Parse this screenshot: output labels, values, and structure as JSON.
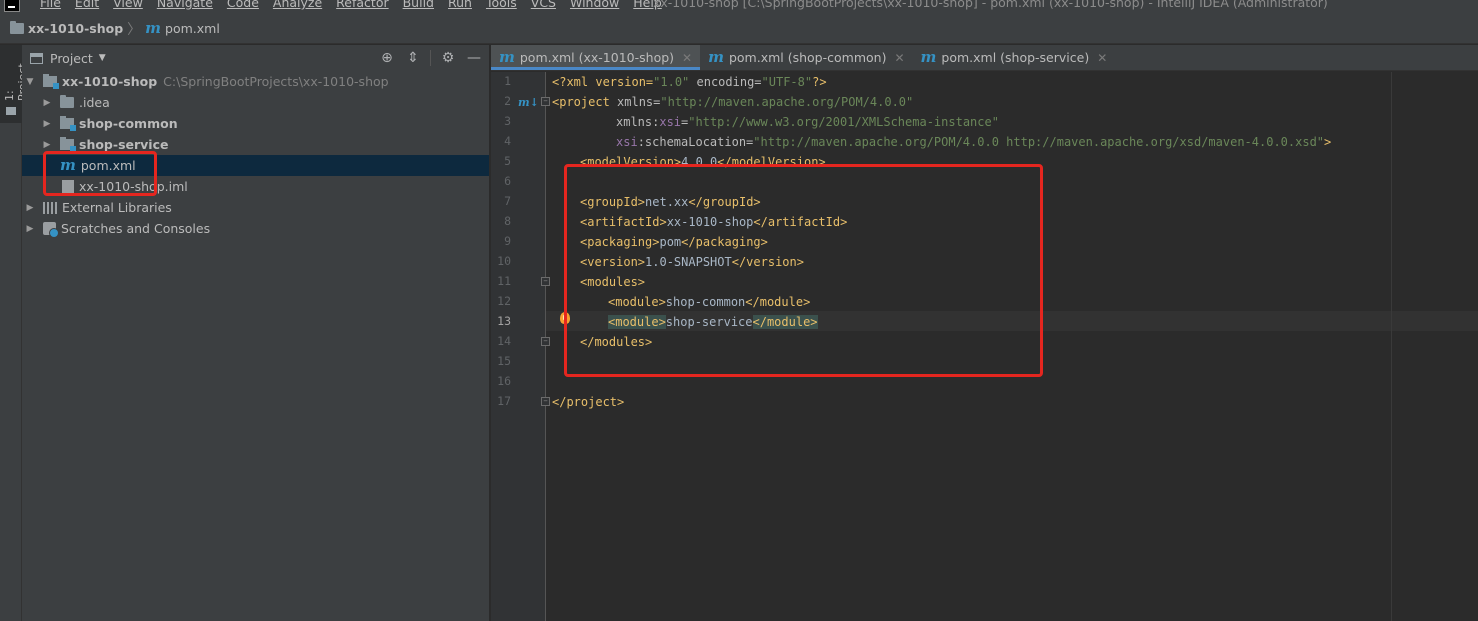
{
  "window": {
    "title": "xx-1010-shop [C:\\SpringBootProjects\\xx-1010-shop] - pom.xml (xx-1010-shop) - IntelliJ IDEA (Administrator)"
  },
  "menu": [
    "File",
    "Edit",
    "View",
    "Navigate",
    "Code",
    "Analyze",
    "Refactor",
    "Build",
    "Run",
    "Tools",
    "VCS",
    "Window",
    "Help"
  ],
  "breadcrumb": {
    "project": "xx-1010-shop",
    "file": "pom.xml"
  },
  "toolstrip": {
    "project_tab": "1: Project"
  },
  "project_panel": {
    "title": "Project",
    "tree": [
      {
        "label": "xx-1010-shop",
        "path": "C:\\SpringBootProjects\\xx-1010-shop"
      },
      {
        "label": ".idea"
      },
      {
        "label": "shop-common"
      },
      {
        "label": "shop-service"
      },
      {
        "label": "pom.xml"
      },
      {
        "label": "xx-1010-shop.iml"
      },
      {
        "label": "External Libraries"
      },
      {
        "label": "Scratches and Consoles"
      }
    ]
  },
  "editor": {
    "tabs": [
      {
        "label": "pom.xml (xx-1010-shop)",
        "active": true
      },
      {
        "label": "pom.xml (shop-common)",
        "active": false
      },
      {
        "label": "pom.xml (shop-service)",
        "active": false
      }
    ],
    "current_line": 13,
    "line_numbers": [
      "1",
      "2",
      "3",
      "4",
      "5",
      "6",
      "7",
      "8",
      "9",
      "10",
      "11",
      "12",
      "13",
      "14",
      "15",
      "16",
      "17"
    ],
    "code": {
      "l1_open": "<?xml version=",
      "l1_v": "\"1.0\"",
      "l1_mid": " encoding=",
      "l1_e": "\"UTF-8\"",
      "l1_close": "?>",
      "l2_tag": "<project ",
      "l2_attr": "xmlns=",
      "l2_val": "\"http://maven.apache.org/POM/4.0.0\"",
      "l3_attr": "xmlns:",
      "l3_ns": "xsi",
      "l3_eq": "=",
      "l3_val": "\"http://www.w3.org/2001/XMLSchema-instance\"",
      "l4_ns": "xsi",
      "l4_attr": ":schemaLocation=",
      "l4_val": "\"http://maven.apache.org/POM/4.0.0 http://maven.apache.org/xsd/maven-4.0.0.xsd\"",
      "l4_close": ">",
      "l5_open": "<modelVersion>",
      "l5_text": "4.0.0",
      "l5_close": "</modelVersion>",
      "l7_open": "<groupId>",
      "l7_text": "net.xx",
      "l7_close": "</groupId>",
      "l8_open": "<artifactId>",
      "l8_text": "xx-1010-shop",
      "l8_close": "</artifactId>",
      "l9_open": "<packaging>",
      "l9_text": "pom",
      "l9_close": "</packaging>",
      "l10_open": "<version>",
      "l10_text": "1.0-SNAPSHOT",
      "l10_close": "</version>",
      "l11": "<modules>",
      "l12_open": "<module>",
      "l12_text": "shop-common",
      "l12_close": "</module>",
      "l13_open": "<module>",
      "l13_text": "shop-service",
      "l13_close": "</module>",
      "l14": "</modules>",
      "l17": "</project>"
    }
  },
  "colors": {
    "annotation_red": "#e5261f",
    "selection": "#0d293e",
    "accent": "#4a88c7"
  }
}
